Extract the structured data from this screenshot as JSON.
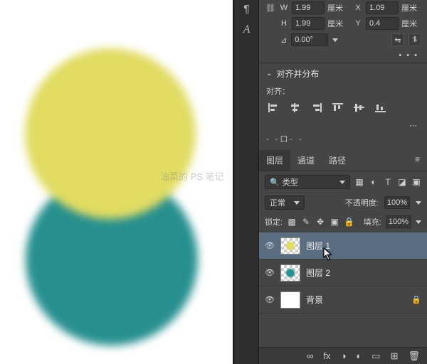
{
  "canvas": {
    "watermark": "油菜的 PS 笔记"
  },
  "properties": {
    "w_label": "W",
    "w_value": "1.99",
    "w_unit": "厘米",
    "x_label": "X",
    "x_value": "1.09",
    "x_unit": "厘米",
    "h_label": "H",
    "h_value": "1.99",
    "h_unit": "厘米",
    "y_label": "Y",
    "y_value": "0.4",
    "y_unit": "厘米",
    "rotation_icon": "⊿",
    "rotation_value": "0.00°",
    "flip_h_icon": "⇋",
    "flip_v_icon": "⥮",
    "dots": "• • •"
  },
  "align_section": {
    "title": "对齐并分布",
    "label": "对齐："
  },
  "layers_panel": {
    "tabs": {
      "layers": "图层",
      "channels": "通道",
      "paths": "路径"
    },
    "filter": {
      "search": "search",
      "kind": "类型"
    },
    "blend": {
      "mode": "正常",
      "opacity_label": "不透明度:",
      "opacity_value": "100%"
    },
    "lock": {
      "label": "锁定:",
      "fill_label": "填充:",
      "fill_value": "100%"
    },
    "rows": [
      {
        "name": "图层 1"
      },
      {
        "name": "图层 2"
      },
      {
        "name": "背景"
      }
    ]
  },
  "footer_icons": [
    "∞",
    "fx",
    "◑",
    "◐",
    "▭",
    "⊞",
    "🗑"
  ]
}
